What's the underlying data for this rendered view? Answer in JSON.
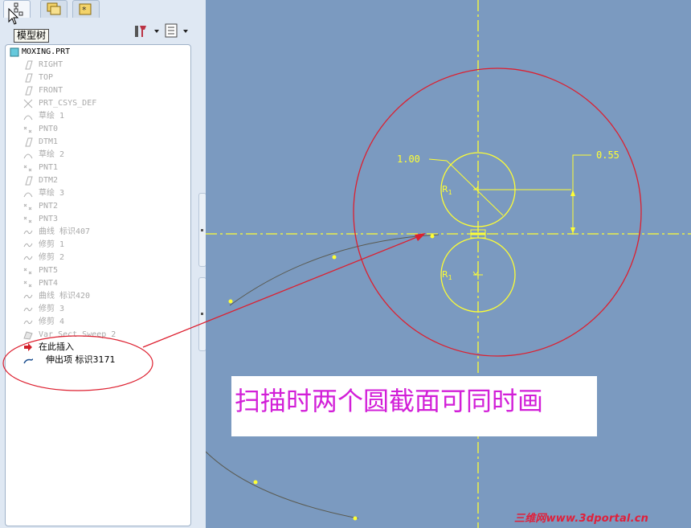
{
  "tooltip": "模型树",
  "tree": {
    "root": "MOXING.PRT",
    "items": [
      {
        "label": "RIGHT",
        "icon": "datum-plane-icon"
      },
      {
        "label": "TOP",
        "icon": "datum-plane-icon"
      },
      {
        "label": "FRONT",
        "icon": "datum-plane-icon"
      },
      {
        "label": "PRT_CSYS_DEF",
        "icon": "csys-icon"
      },
      {
        "label": "草绘 1",
        "icon": "sketch-icon"
      },
      {
        "label": "PNT0",
        "icon": "datum-point-icon"
      },
      {
        "label": "DTM1",
        "icon": "datum-plane-icon"
      },
      {
        "label": "草绘 2",
        "icon": "sketch-icon"
      },
      {
        "label": "PNT1",
        "icon": "datum-point-icon"
      },
      {
        "label": "DTM2",
        "icon": "datum-plane-icon"
      },
      {
        "label": "草绘 3",
        "icon": "sketch-icon"
      },
      {
        "label": "PNT2",
        "icon": "datum-point-icon"
      },
      {
        "label": "PNT3",
        "icon": "datum-point-icon"
      },
      {
        "label": "曲线 标识407",
        "icon": "curve-icon"
      },
      {
        "label": "修剪 1",
        "icon": "trim-icon"
      },
      {
        "label": "修剪 2",
        "icon": "trim-icon"
      },
      {
        "label": "PNT5",
        "icon": "datum-point-icon"
      },
      {
        "label": "PNT4",
        "icon": "datum-point-icon"
      },
      {
        "label": "曲线 标识420",
        "icon": "curve-icon"
      },
      {
        "label": "修剪 3",
        "icon": "trim-icon"
      },
      {
        "label": "修剪 4",
        "icon": "trim-icon"
      },
      {
        "label": "Var Sect Sweep 2",
        "icon": "sweep-icon"
      }
    ],
    "insert_here": "在此插入",
    "active_feature": "伸出项 标识3171"
  },
  "dimensions": {
    "diameter": "1.00",
    "offset": "0.55",
    "radius_label": "R",
    "radius_subscript": "1"
  },
  "annotation": "扫描时两个圆截面可同时画",
  "watermark": "三维网www.3dportal.cn",
  "colors": {
    "canvas": "#7b9ac0",
    "sketch": "#ffff33",
    "callout": "#dd1f2f",
    "note_text": "#d21fd8"
  }
}
